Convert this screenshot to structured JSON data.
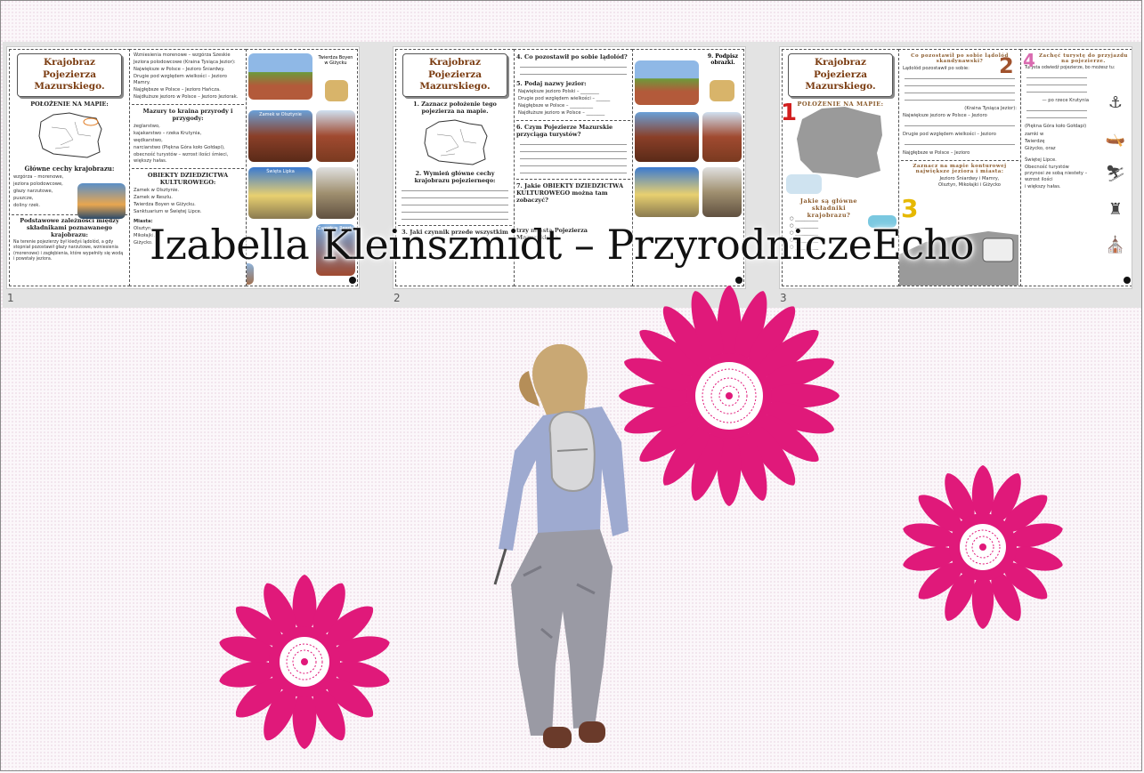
{
  "slides": [
    {
      "number": "1",
      "title": "Krajobraz Pojezierza Mazurskiego.",
      "map_heading": "POŁOŻENIE NA MAPIE:",
      "features_heading": "Główne cechy krajobrazu:",
      "features": [
        "wzgórza – morenowe,",
        "jeziora polodowcowe,",
        "głazy narzutowe,",
        "puszcze,",
        "doliny rzek."
      ],
      "relations_heading": "Podstawowe zależności między składnikami poznawanego krajobrazu:",
      "relations_text": "Na terenie pojezierzy był kiedyś lądolód, a gdy stopniał pozostawił głazy narzutowe, wzniesienia (morenowe) i zagłębienia, które wypełniły się wodą i powstały jeziora.",
      "facts": [
        "Wzniesienia morenowe – wzgórza Szeskie",
        "Jeziora polodowcowe (Kraina Tysiąca Jezior):",
        "Największe w Polsce – Jezioro Śniardwy.",
        "Drugie pod względem wielkości – Jezioro Mamry.",
        "Najgłębsze w Polsce – Jezioro Hańcza.",
        "Najdłuższe jezioro w Polsce – Jezioro Jeziorak."
      ],
      "nature_heading": "Mazury to kraina przyrody i przygody:",
      "nature_items": [
        "żeglarstwo,",
        "kajakarstwo – rzeka Krutynia,",
        "wędkarstwo,",
        "narciarstwo (Piękna Góra koło Gołdapi),",
        "obecność turystów – wzrost ilości śmieci, większy hałas."
      ],
      "heritage_heading": "OBIEKTY DZIEDZICTWA KULTUROWEGO:",
      "heritage_items": [
        "Zamek w Olsztynie.",
        "Zamek w Reszlu.",
        "Twierdza Boyen w Giżycku.",
        "Sanktuarium w Świętej Lipce."
      ],
      "cities_heading": "Miasta:",
      "cities": [
        "Olsztyn,",
        "Mikołajki,",
        "Giżycko."
      ],
      "photo_labels": [
        "Twierdza Boyen w Giżycku",
        "Zamek w Olsztynie",
        "Święta Lipka",
        "Zamek w Reszlu"
      ]
    },
    {
      "number": "2",
      "title": "Krajobraz Pojezierza Mazurskiego.",
      "task1": "1. Zaznacz położenie tego pojezierza na mapie.",
      "task2": "2. Wymień główne cechy krajobrazu pojezierneqo:",
      "task3": "3. Jaki czynnik przede wszystkim",
      "task4": "4. Co pozostawił po sobie lądolód?",
      "task5": "5. Podaj nazwy jezior:",
      "task5_items": [
        "Największe jezioro Polski – ________",
        "Drugie pod względem wielkości – ______",
        "Najgłębsze w Polsce – __________",
        "Najdłuższe jezioro w Polsce – ________"
      ],
      "task6": "6. Czym Pojezierze Mazurskie przyciąga turystów?",
      "task7": "7. Jakie OBIEKTY DZIEDZICTWA KULTUROWEGO można tam zobaczyć?",
      "task8": "trzy miasta Pojezierza Mazurskiego.",
      "task9": "9. Podpisz obrazki."
    },
    {
      "number": "3",
      "title": "Krajobraz Pojezierza Mazurskiego.",
      "map_heading": "POŁOŻENIE NA MAPIE:",
      "components_heading": "Jakie są główne składniki krajobrazu?",
      "glacier_heading": "Co pozostawił po sobie lądolód skandynawski?",
      "glacier_intro": "Lądolód pozostawił po sobie:",
      "glacier_items": [
        "(Kraina Tysiąca Jezior):",
        "Największe jezioro w Polsce – Jezioro",
        "Drugie pod względem wielkości – Jezioro",
        "Najgłębsze w Polsce – Jezioro"
      ],
      "lakes_heading": "Zaznacz na mapie konturowej największe jeziora i miasta:",
      "lakes_text": "Jezioro Śniardwy i Mamry, Olsztyn, Mikołajki i Giżycko",
      "tourists_heading": "Zachęć turystę do przyjazdu na pojezierze.",
      "tourists_intro": "Turysta odwiedź pojezierze, bo możesz tu:",
      "tourists_items": [
        "— po rzece Krutynia",
        "(Piękna Góra koło Gołdapi)",
        "zamki w",
        "Twierdzę",
        "Giżycko, oraz",
        "Świętej Lipce.",
        "Obecność turystów przynosi ze sobą niestety – wzrost ilości",
        "i większy hałas."
      ],
      "numbers": [
        "1",
        "2",
        "3",
        "4"
      ]
    }
  ],
  "watermark": "Izabella Kleinszmidt – PrzyrodniczeEcho",
  "colors": {
    "flower": "#e0197a",
    "accent_brown": "#7a3b10",
    "num1": "#d21f1f",
    "num2": "#a0522d",
    "num3": "#e6b800",
    "num4": "#d96bb0"
  }
}
